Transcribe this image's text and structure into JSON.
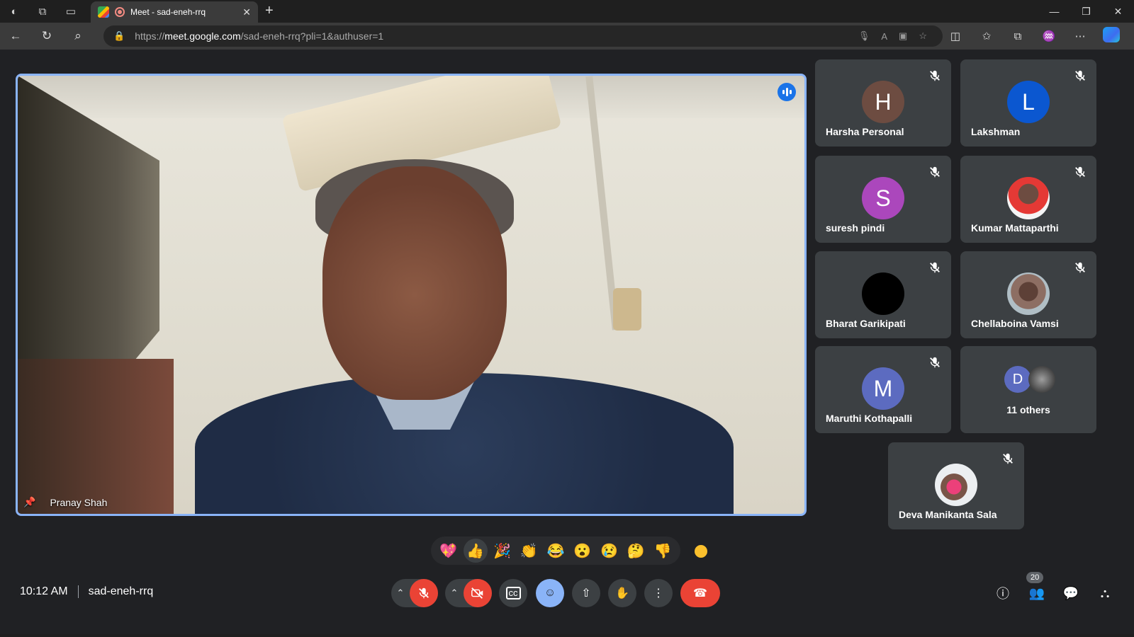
{
  "browser": {
    "tab_title": "Meet - sad-eneh-rrq",
    "url_prefix": "https://",
    "url_host": "meet.google.com",
    "url_path": "/sad-eneh-rrq?pli=1&authuser=1"
  },
  "main_speaker": {
    "name": "Pranay Shah"
  },
  "participants": [
    {
      "name": "Harsha Personal",
      "initial": "H",
      "color": "#6d4c41"
    },
    {
      "name": "Lakshman",
      "initial": "L",
      "color": "#0b57d0"
    },
    {
      "name": "suresh pindi",
      "initial": "S",
      "color": "#ab47bc"
    },
    {
      "name": "Kumar Mattaparthi",
      "initial": "",
      "color": "#ffffff"
    },
    {
      "name": "Bharat Garikipati",
      "initial": "",
      "color": "#000000"
    },
    {
      "name": "Chellaboina Vamsi",
      "initial": "",
      "color": "#8d6e63"
    },
    {
      "name": "Maruthi Kothapalli",
      "initial": "M",
      "color": "#5c6bc0"
    },
    {
      "name": "Deva Manikanta Sala",
      "initial": "",
      "color": "#cfd8dc"
    }
  ],
  "others": {
    "initial": "D",
    "label": "11 others",
    "color": "#5c6bc0"
  },
  "reactions": [
    "💖",
    "👍",
    "🎉",
    "👏",
    "😂",
    "😮",
    "😢",
    "🤔",
    "👎"
  ],
  "meeting": {
    "time": "10:12 AM",
    "code": "sad-eneh-rrq"
  },
  "people_count": "20"
}
